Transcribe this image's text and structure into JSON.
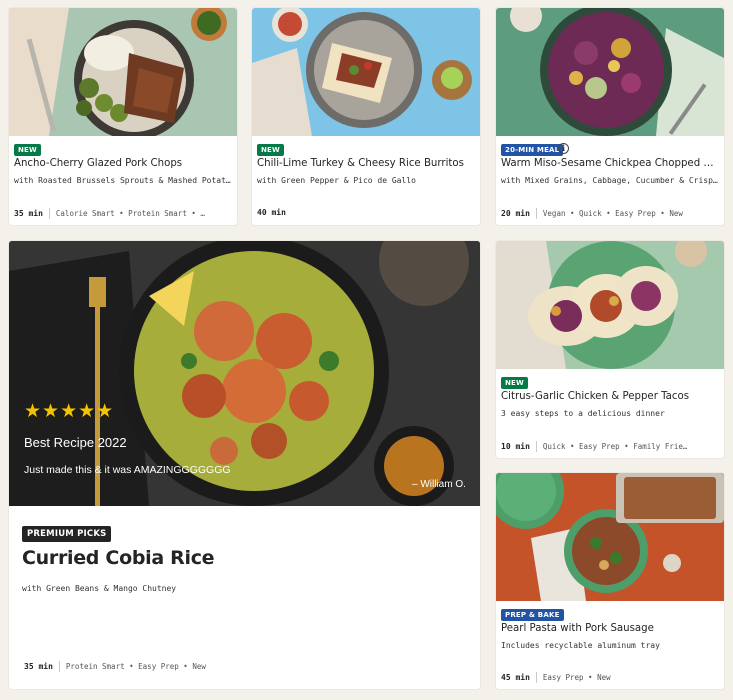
{
  "cards": [
    {
      "badge": "NEW",
      "title": "Ancho-Cherry Glazed Pork Chops",
      "subtitle": "with Roasted Brussels Sprouts & Mashed Potatoes",
      "time": "35 min",
      "tags": "Calorie Smart • Protein Smart • …"
    },
    {
      "badge": "NEW",
      "title": "Chili-Lime Turkey & Cheesy Rice Burritos",
      "subtitle": "with Green Pepper & Pico de Gallo",
      "time": "40 min",
      "tags": ""
    },
    {
      "badge": "20-MIN MEAL",
      "title": "Warm Miso-Sesame Chickpea Chopped Sal…",
      "subtitle": "with Mixed Grains, Cabbage, Cucumber & Crispy Wo…",
      "time": "20 min",
      "tags": "Vegan • Quick • Easy Prep • New"
    },
    {
      "badge": "NEW",
      "title": "Citrus-Garlic Chicken & Pepper Tacos",
      "subtitle": "3 easy steps to a delicious dinner",
      "time": "10 min",
      "tags": "Quick • Easy Prep • Family Frie…"
    },
    {
      "badge": "PREP & BAKE",
      "title": "Pearl Pasta with Pork Sausage",
      "subtitle": "Includes recyclable aluminum tray",
      "time": "45 min",
      "tags": "Easy Prep • New"
    }
  ],
  "featured": {
    "badge": "PREMIUM PICKS",
    "title": "Curried Cobia Rice",
    "subtitle": "with Green Beans & Mango Chutney",
    "time": "35 min",
    "tags": "Protein Smart • Easy Prep • New",
    "review": {
      "stars": "★★★★★",
      "title": "Best Recipe 2022",
      "text": "Just made this & it was AMAZINGGGGGGG",
      "author": "– William O."
    }
  },
  "colors": {
    "badge_green": "#067a46",
    "badge_blue": "#2254a6",
    "badge_dark": "#242424",
    "star": "#f4c400",
    "page_bg": "#f4f1ea"
  },
  "icons": [
    "info-icon",
    "star-icon"
  ]
}
